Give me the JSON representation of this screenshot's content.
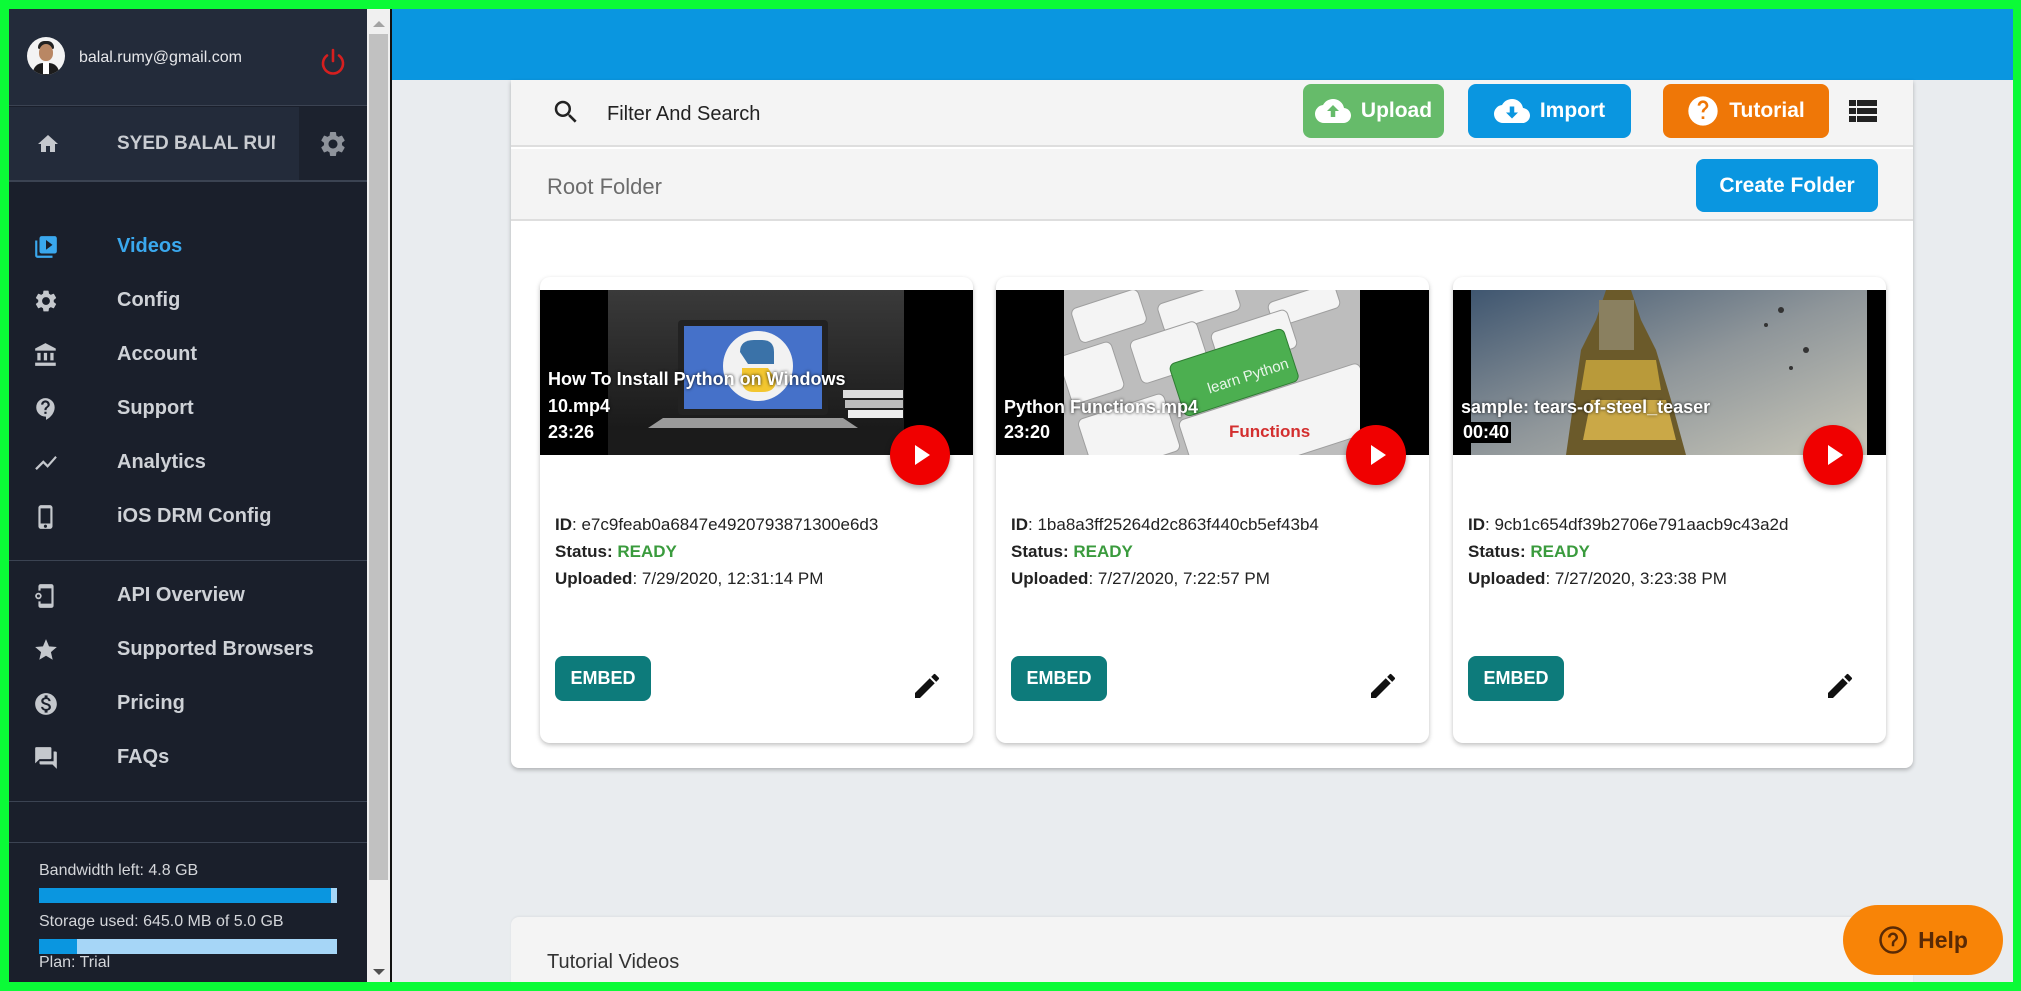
{
  "sidebar": {
    "user_email": "balal.rumy@gmail.com",
    "account_name": "SYED BALAL RUMY",
    "nav_primary": [
      {
        "label": "Videos",
        "icon": "video-library-icon",
        "active": true
      },
      {
        "label": "Config",
        "icon": "gear-icon",
        "active": false
      },
      {
        "label": "Account",
        "icon": "bank-icon",
        "active": false
      },
      {
        "label": "Support",
        "icon": "help-bubble-icon",
        "active": false
      },
      {
        "label": "Analytics",
        "icon": "trend-line-icon",
        "active": false
      },
      {
        "label": "iOS DRM Config",
        "icon": "phone-icon",
        "active": false
      }
    ],
    "nav_secondary": [
      {
        "label": "API Overview",
        "icon": "api-phone-icon"
      },
      {
        "label": "Supported Browsers",
        "icon": "star-icon"
      },
      {
        "label": "Pricing",
        "icon": "dollar-icon"
      },
      {
        "label": "FAQs",
        "icon": "forum-icon"
      }
    ],
    "usage": {
      "bandwidth_label": "Bandwidth left: 4.8 GB",
      "bandwidth_fraction": 0.98,
      "storage_label": "Storage used: 645.0 MB of 5.0 GB",
      "storage_fraction": 0.129,
      "plan_label": "Plan: Trial"
    }
  },
  "toolbar": {
    "search_placeholder": "Filter And Search",
    "upload_label": "Upload",
    "import_label": "Import",
    "tutorial_label": "Tutorial"
  },
  "folder": {
    "title": "Root Folder",
    "create_label": "Create Folder"
  },
  "videos": [
    {
      "title": "How To Install Python on Windows 10.mp4",
      "duration": "23:26",
      "id_label": "ID",
      "id": "e7c9feab0a6847e4920793871300e6d3",
      "status_label": "Status:",
      "status": "READY",
      "uploaded_label": "Uploaded",
      "uploaded": "7/29/2020, 12:31:14 PM",
      "embed_label": "EMBED"
    },
    {
      "title": "Python Functions.mp4",
      "duration": "23:20",
      "id_label": "ID",
      "id": "1ba8a3ff25264d2c863f440cb5ef43b4",
      "status_label": "Status:",
      "status": "READY",
      "uploaded_label": "Uploaded",
      "uploaded": "7/27/2020, 7:22:57 PM",
      "embed_label": "EMBED"
    },
    {
      "title": "sample: tears-of-steel_teaser",
      "duration": "00:40",
      "id_label": "ID",
      "id": "9cb1c654df39b2706e791aacb9c43a2d",
      "status_label": "Status:",
      "status": "READY",
      "uploaded_label": "Uploaded",
      "uploaded": "7/27/2020, 3:23:38 PM",
      "embed_label": "EMBED"
    }
  ],
  "tutorial_section": {
    "title": "Tutorial Videos"
  },
  "help": {
    "label": "Help"
  },
  "colors": {
    "header_blue": "#0a96e0",
    "upload_green": "#66bb6a",
    "tutorial_orange": "#ef7707",
    "embed_teal": "#0d7b7b",
    "status_ready": "#3a9b3d",
    "play_red": "#f00000",
    "help_orange": "#f88407",
    "active_nav": "#3aa8ee"
  }
}
